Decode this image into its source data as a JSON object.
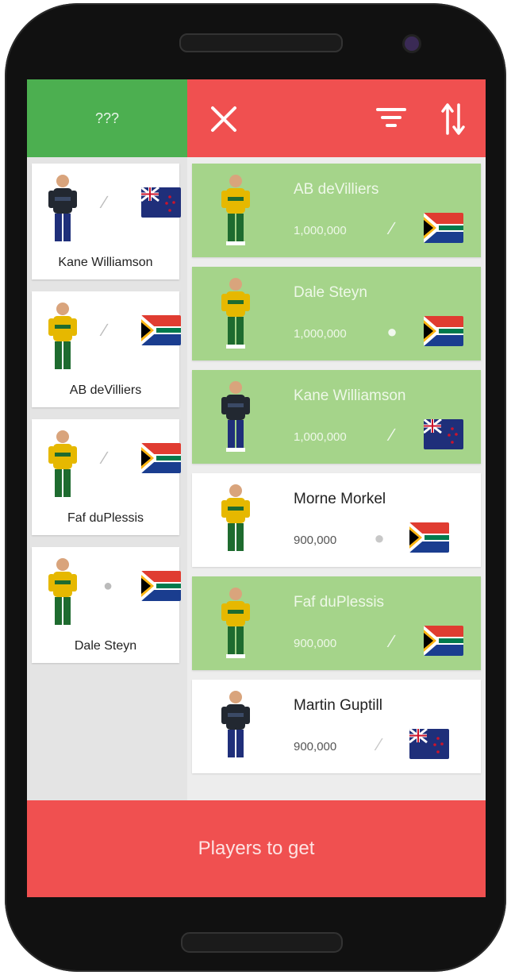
{
  "left": {
    "header_label": "???",
    "cards": [
      {
        "name": "Kane Williamson",
        "role_icon": "bat-icon",
        "country": "New Zealand",
        "kit": "black"
      },
      {
        "name": "AB deVilliers",
        "role_icon": "bat-icon",
        "country": "South Africa",
        "kit": "green"
      },
      {
        "name": "Faf duPlessis",
        "role_icon": "bat-icon",
        "country": "South Africa",
        "kit": "green"
      },
      {
        "name": "Dale Steyn",
        "role_icon": "ball-icon",
        "country": "South Africa",
        "kit": "green"
      }
    ]
  },
  "right": {
    "header_icons": [
      "close-icon",
      "filter-icon",
      "sort-icon"
    ],
    "cards": [
      {
        "name": "AB deVilliers",
        "price": "1,000,000",
        "role_icon": "bat-icon",
        "country": "South Africa",
        "kit": "green",
        "selected": true
      },
      {
        "name": "Dale Steyn",
        "price": "1,000,000",
        "role_icon": "ball-icon",
        "country": "South Africa",
        "kit": "green",
        "selected": true
      },
      {
        "name": "Kane Williamson",
        "price": "1,000,000",
        "role_icon": "bat-icon",
        "country": "New Zealand",
        "kit": "black",
        "selected": true
      },
      {
        "name": "Morne Morkel",
        "price": "900,000",
        "role_icon": "ball-icon",
        "country": "South Africa",
        "kit": "green",
        "selected": false
      },
      {
        "name": "Faf duPlessis",
        "price": "900,000",
        "role_icon": "bat-icon",
        "country": "South Africa",
        "kit": "green",
        "selected": true
      },
      {
        "name": "Martin Guptill",
        "price": "900,000",
        "role_icon": "bat-icon",
        "country": "New Zealand",
        "kit": "black",
        "selected": false
      }
    ]
  },
  "bottom_button": "Players to get",
  "colors": {
    "green": "#4caf50",
    "selected_card": "#a5d48a",
    "red": "#f05050"
  }
}
